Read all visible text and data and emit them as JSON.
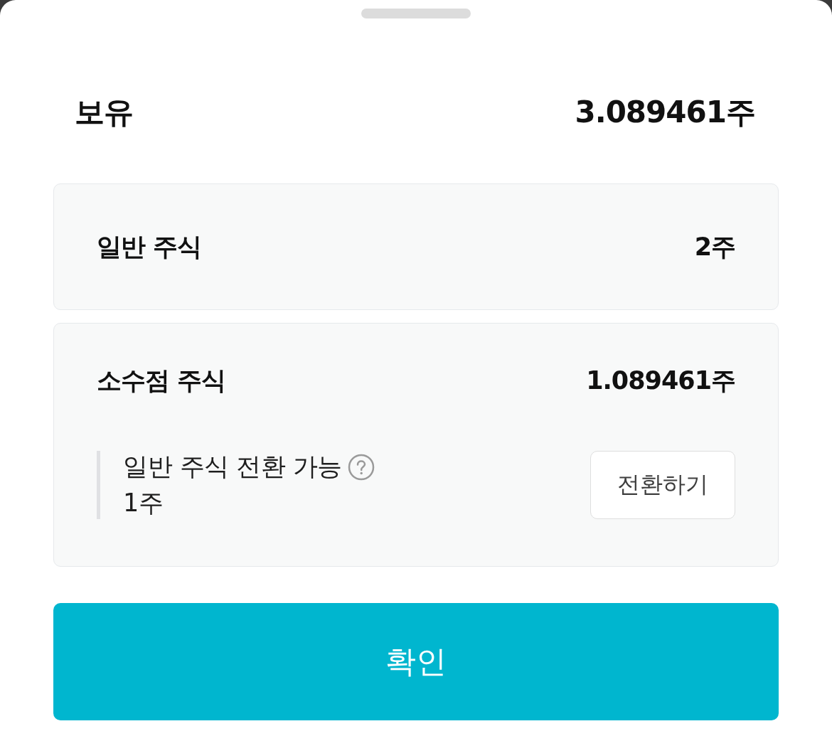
{
  "holding": {
    "label": "보유",
    "value": "3.089461주"
  },
  "cards": [
    {
      "kind": "plain",
      "label": "일반 주식",
      "value": "2주"
    },
    {
      "kind": "convertible",
      "label": "소수점 주식",
      "value": "1.089461주",
      "conversion": {
        "label": "일반 주식 전환 가능",
        "amount": "1주",
        "button": "전환하기"
      }
    }
  ],
  "confirm_button": "확인"
}
